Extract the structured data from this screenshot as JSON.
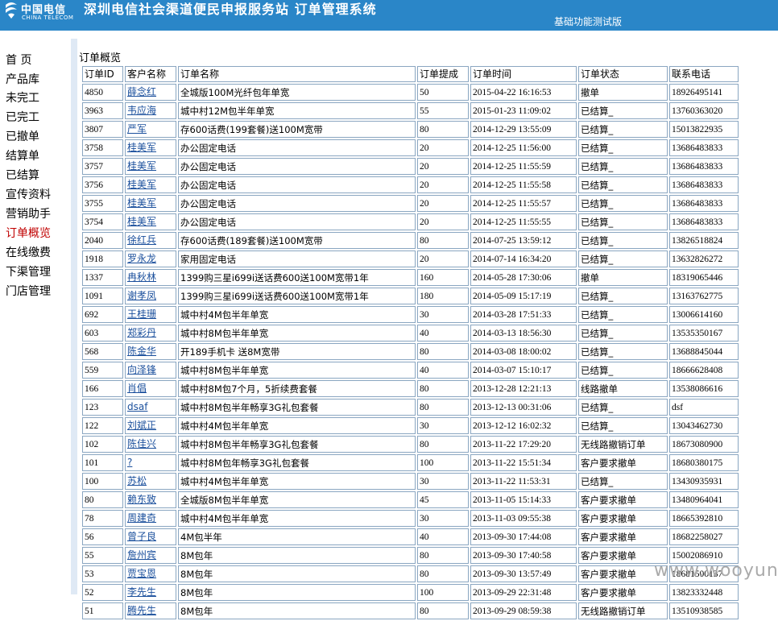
{
  "header": {
    "logo_cn": "中国电信",
    "logo_en": "CHINA TELECOM",
    "title": "深圳电信社会渠道便民申报服务站  订单管理系统",
    "version": "基础功能测试版"
  },
  "sidebar": {
    "items": [
      {
        "label": "首 页"
      },
      {
        "label": "产品库"
      },
      {
        "label": "未完工"
      },
      {
        "label": "已完工"
      },
      {
        "label": "已撤单"
      },
      {
        "label": "结算单"
      },
      {
        "label": "已结算"
      },
      {
        "label": "宣传资料"
      },
      {
        "label": "营销助手"
      },
      {
        "label": "订单概览",
        "active": true
      },
      {
        "label": "在线缴费"
      },
      {
        "label": "下渠管理"
      },
      {
        "label": "门店管理"
      }
    ]
  },
  "page_title": "订单概览",
  "table": {
    "columns": [
      "订单ID",
      "客户名称",
      "订单名称",
      "订单提成",
      "订单时间",
      "订单状态",
      "联系电话"
    ],
    "rows": [
      [
        "4850",
        "薛念红",
        "全城版100M光纤包年单宽",
        "50",
        "2015-04-22 16:16:53",
        "撤单",
        "18926495141"
      ],
      [
        "3963",
        "韦应海",
        "城中村12M包半年单宽",
        "55",
        "2015-01-23 11:09:02",
        "已结算_",
        "13760363020"
      ],
      [
        "3807",
        "严军",
        "存600话费(199套餐)送100M宽带",
        "80",
        "2014-12-29 13:55:09",
        "已结算_",
        "15013822935"
      ],
      [
        "3758",
        "桂美军",
        "办公固定电话",
        "20",
        "2014-12-25 11:56:00",
        "已结算_",
        "13686483833"
      ],
      [
        "3757",
        "桂美军",
        "办公固定电话",
        "20",
        "2014-12-25 11:55:59",
        "已结算_",
        "13686483833"
      ],
      [
        "3756",
        "桂美军",
        "办公固定电话",
        "20",
        "2014-12-25 11:55:58",
        "已结算_",
        "13686483833"
      ],
      [
        "3755",
        "桂美军",
        "办公固定电话",
        "20",
        "2014-12-25 11:55:57",
        "已结算_",
        "13686483833"
      ],
      [
        "3754",
        "桂美军",
        "办公固定电话",
        "20",
        "2014-12-25 11:55:55",
        "已结算_",
        "13686483833"
      ],
      [
        "2040",
        "徐红兵",
        "存600话费(189套餐)送100M宽带",
        "80",
        "2014-07-25 13:59:12",
        "已结算_",
        "13826518824"
      ],
      [
        "1918",
        "罗永龙",
        "家用固定电话",
        "20",
        "2014-07-14 16:34:20",
        "已结算_",
        "13632826272"
      ],
      [
        "1337",
        "冉秋林",
        "1399购三星i699i送话费600送100M宽带1年",
        "160",
        "2014-05-28 17:30:06",
        "撤单",
        "18319065446"
      ],
      [
        "1091",
        "谢孝凤",
        "1399购三星i699i送话费600送100M宽带1年",
        "180",
        "2014-05-09 15:17:19",
        "已结算_",
        "13163762775"
      ],
      [
        "692",
        "王桂珊",
        "城中村4M包半年单宽",
        "30",
        "2014-03-28 17:51:33",
        "已结算_",
        "13006614160"
      ],
      [
        "603",
        "郑彩丹",
        "城中村8M包半年单宽",
        "40",
        "2014-03-13 18:56:30",
        "已结算_",
        "13535350167"
      ],
      [
        "568",
        "陈金华",
        "开189手机卡 送8M宽带",
        "80",
        "2014-03-08 18:00:02",
        "已结算_",
        "13688845044"
      ],
      [
        "559",
        "向泽锋",
        "城中村8M包半年单宽",
        "40",
        "2014-03-07 15:10:17",
        "已结算_",
        "18666628408"
      ],
      [
        "166",
        "肖倡",
        "城中村8M包7个月，5折续费套餐",
        "80",
        "2013-12-28 12:21:13",
        "线路撤单",
        "13538086616"
      ],
      [
        "123",
        "dsaf",
        "城中村8M包半年畅享3G礼包套餐",
        "80",
        "2013-12-13 00:31:06",
        "已结算_",
        "dsf"
      ],
      [
        "122",
        "刘斌正",
        "城中村4M包半年单宽",
        "30",
        "2013-12-12 16:02:32",
        "已结算_",
        "13043462730"
      ],
      [
        "102",
        "陈佳兴",
        "城中村8M包半年畅享3G礼包套餐",
        "80",
        "2013-11-22 17:29:20",
        "无线路撤销订单",
        "18673080900"
      ],
      [
        "101",
        "?",
        "城中村8M包年畅享3G礼包套餐",
        "100",
        "2013-11-22 15:51:34",
        "客户要求撤单",
        "18680380175"
      ],
      [
        "100",
        "苏松",
        "城中村4M包半年单宽",
        "30",
        "2013-11-22 11:53:31",
        "已结算_",
        "13430935931"
      ],
      [
        "80",
        "赖东致",
        "全城版8M包半年单宽",
        "45",
        "2013-11-05 15:14:33",
        "客户要求撤单",
        "13480964041"
      ],
      [
        "78",
        "周建奇",
        "城中村4M包半年单宽",
        "30",
        "2013-11-03 09:55:38",
        "客户要求撤单",
        "18665392810"
      ],
      [
        "56",
        "曾子良",
        "4M包半年",
        "40",
        "2013-09-30 17:44:08",
        "客户要求撤单",
        "18682258027"
      ],
      [
        "55",
        "詹州宾",
        "8M包年",
        "80",
        "2013-09-30 17:40:58",
        "客户要求撤单",
        "15002086910"
      ],
      [
        "53",
        "贾宝恩",
        "8M包年",
        "80",
        "2013-09-30 13:57:49",
        "客户要求撤单",
        "18681500137"
      ],
      [
        "52",
        "李先生",
        "8M包年",
        "100",
        "2013-09-29 22:31:48",
        "客户要求撤单",
        "13823332448"
      ],
      [
        "51",
        "腾先生",
        "8M包年",
        "80",
        "2013-09-29 08:59:38",
        "无线路撤销订单",
        "13510938585"
      ]
    ]
  },
  "watermark": "www.wooyun.org"
}
